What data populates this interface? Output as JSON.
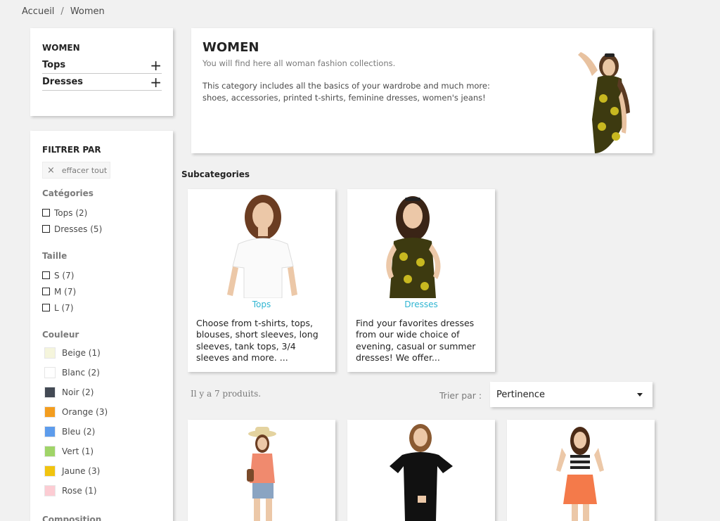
{
  "breadcrumb": {
    "home": "Accueil",
    "separator": "/",
    "current": "Women"
  },
  "category_tree": {
    "title": "WOMEN",
    "items": [
      {
        "label": "Tops"
      },
      {
        "label": "Dresses"
      }
    ],
    "expand_symbol": "+"
  },
  "filters": {
    "title": "FILTRER PAR",
    "clear_all": "effacer tout",
    "clear_icon": "×",
    "categories": {
      "title": "Catégories",
      "items": [
        "Tops (2)",
        "Dresses (5)"
      ]
    },
    "size": {
      "title": "Taille",
      "items": [
        "S (7)",
        "M (7)",
        "L (7)"
      ]
    },
    "color": {
      "title": "Couleur",
      "items": [
        {
          "label": "Beige (1)",
          "color": "#f5f5dc"
        },
        {
          "label": "Blanc (2)",
          "color": "#ffffff"
        },
        {
          "label": "Noir (2)",
          "color": "#434a54"
        },
        {
          "label": "Orange (3)",
          "color": "#f39d1f"
        },
        {
          "label": "Bleu (2)",
          "color": "#5d9cec"
        },
        {
          "label": "Vert (1)",
          "color": "#a0d468"
        },
        {
          "label": "Jaune (3)",
          "color": "#f1c40f"
        },
        {
          "label": "Rose (1)",
          "color": "#fcccd3"
        }
      ]
    },
    "composition": {
      "title": "Composition"
    }
  },
  "header": {
    "title": "WOMEN",
    "subtitle": "You will find here all woman fashion collections.",
    "description": "This category includes all the basics of your wardrobe and much more: shoes, accessories, printed t-shirts, feminine dresses, women's jeans!"
  },
  "subcategories": {
    "title": "Subcategories",
    "items": [
      {
        "name": "Tops",
        "description": "Choose from t-shirts, tops, blouses, short sleeves, long sleeves, tank tops, 3/4 sleeves and more. ..."
      },
      {
        "name": "Dresses",
        "description": "Find your favorites dresses from our wide choice of evening, casual or summer dresses! We offer..."
      }
    ]
  },
  "listing": {
    "count_text": "Il y a 7 produits.",
    "sort_label": "Trier par :",
    "sort_value": "Pertinence"
  },
  "colors": {
    "accent": "#2fb5d2",
    "text": "#232323",
    "muted": "#7a7a7a",
    "background": "#f1f1f1"
  }
}
